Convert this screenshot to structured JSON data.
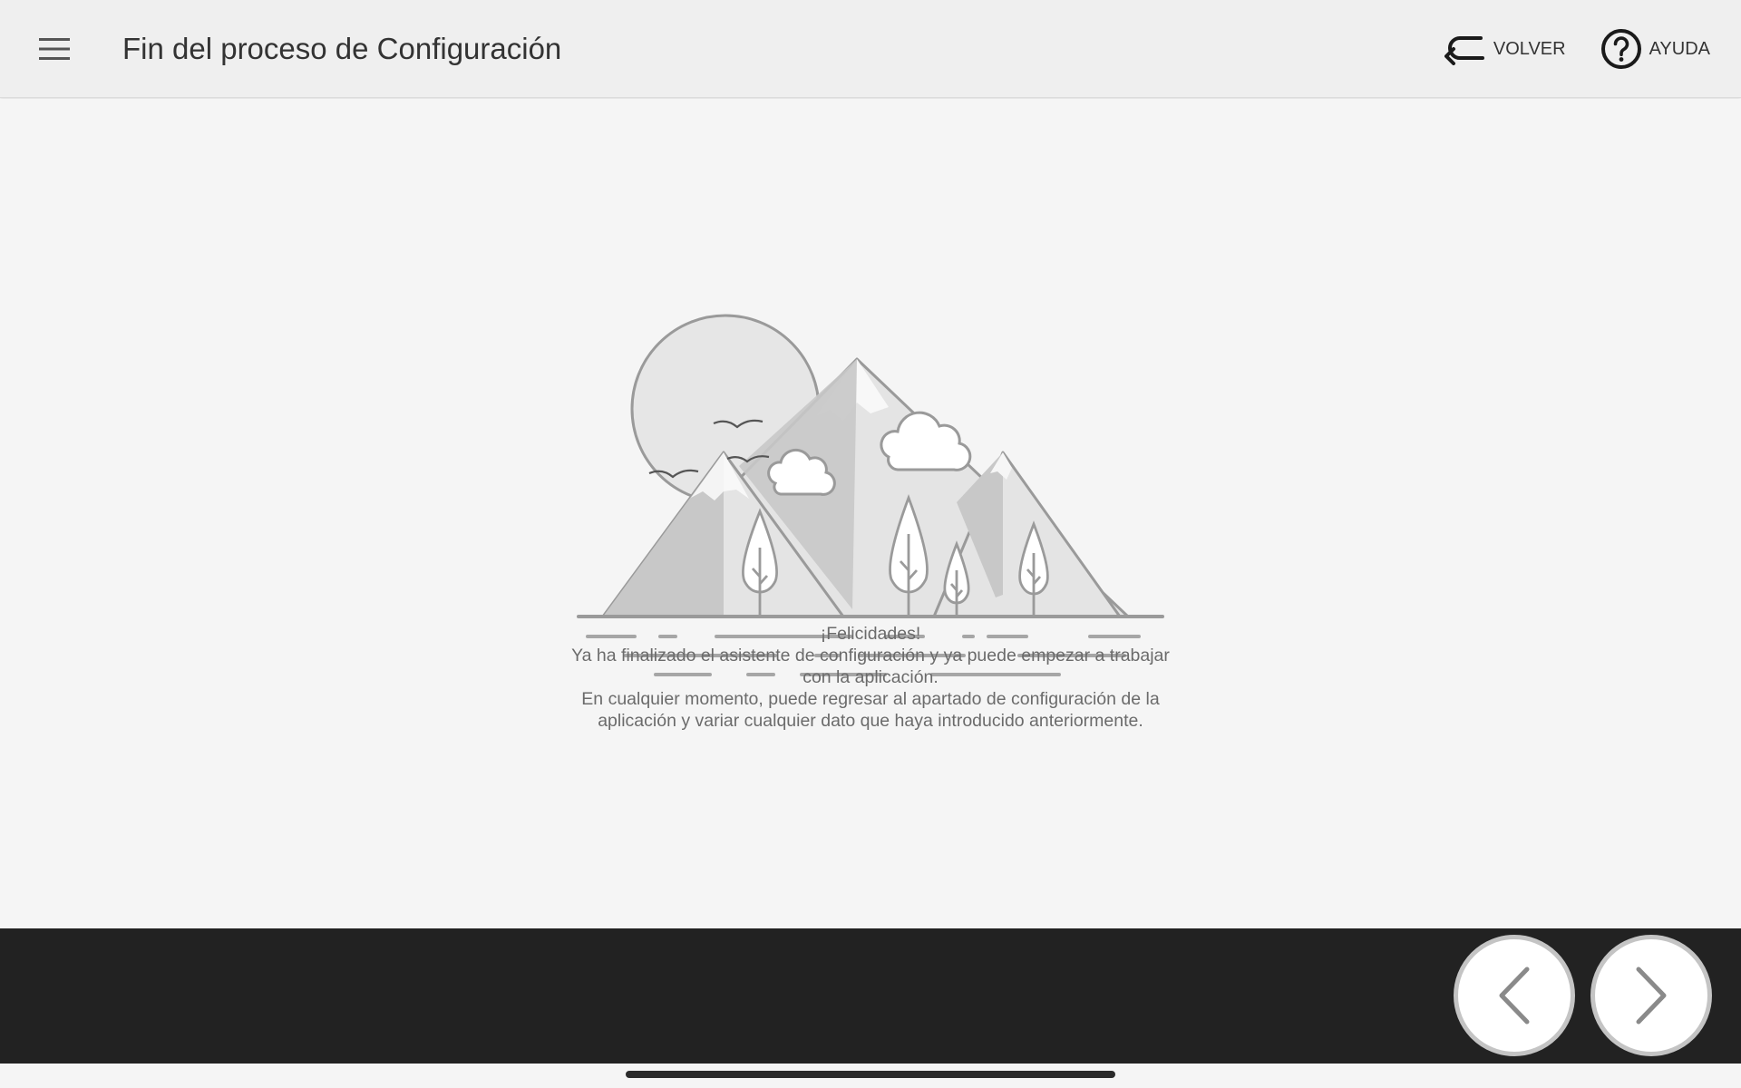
{
  "header": {
    "title": "Fin del proceso de Configuración",
    "menu_icon": "hamburger-menu-icon",
    "back": {
      "label": "VOLVER",
      "icon": "return-arrow-icon"
    },
    "help": {
      "label": "AYUDA",
      "icon": "question-circle-icon"
    }
  },
  "illustration": {
    "name": "mountain-landscape-illustration"
  },
  "message": {
    "line1": "¡Felicidades!",
    "line2": "Ya ha finalizado el asistente de configuración y ya puede empezar a trabajar con la aplicación.",
    "line3": "En cualquier momento, puede regresar al apartado de configuración de la aplicación y variar cualquier dato que haya introducido anteriormente."
  },
  "navigation": {
    "prev_icon": "chevron-left-icon",
    "next_icon": "chevron-right-icon"
  },
  "colors": {
    "header_bg": "#efefef",
    "content_bg": "#f5f5f5",
    "bottom_bar_bg": "#222222",
    "text": "#333333",
    "message_text": "#6b6b6b"
  }
}
